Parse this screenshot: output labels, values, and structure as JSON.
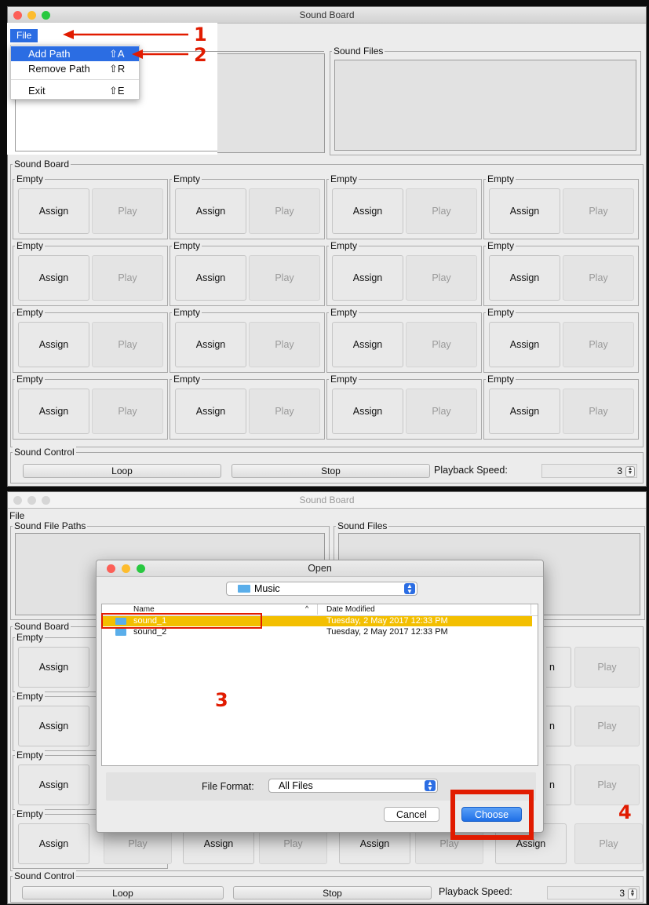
{
  "window1": {
    "title": "Sound Board",
    "menu_file": "File",
    "dropdown": [
      {
        "label": "Add Path",
        "shortcut": "⇧A"
      },
      {
        "label": "Remove Path",
        "shortcut": "⇧R"
      },
      {
        "label": "Exit",
        "shortcut": "⇧E"
      }
    ],
    "sound_files_legend": "Sound Files",
    "sound_board_legend": "Sound Board",
    "sound_control_legend": "Sound Control",
    "cells": [
      {
        "name": "Empty",
        "assign": "Assign",
        "play": "Play"
      },
      {
        "name": "Empty",
        "assign": "Assign",
        "play": "Play"
      },
      {
        "name": "Empty",
        "assign": "Assign",
        "play": "Play"
      },
      {
        "name": "Empty",
        "assign": "Assign",
        "play": "Play"
      },
      {
        "name": "Empty",
        "assign": "Assign",
        "play": "Play"
      },
      {
        "name": "Empty",
        "assign": "Assign",
        "play": "Play"
      },
      {
        "name": "Empty",
        "assign": "Assign",
        "play": "Play"
      },
      {
        "name": "Empty",
        "assign": "Assign",
        "play": "Play"
      },
      {
        "name": "Empty",
        "assign": "Assign",
        "play": "Play"
      },
      {
        "name": "Empty",
        "assign": "Assign",
        "play": "Play"
      },
      {
        "name": "Empty",
        "assign": "Assign",
        "play": "Play"
      },
      {
        "name": "Empty",
        "assign": "Assign",
        "play": "Play"
      },
      {
        "name": "Empty",
        "assign": "Assign",
        "play": "Play"
      },
      {
        "name": "Empty",
        "assign": "Assign",
        "play": "Play"
      },
      {
        "name": "Empty",
        "assign": "Assign",
        "play": "Play"
      },
      {
        "name": "Empty",
        "assign": "Assign",
        "play": "Play"
      }
    ],
    "loop": "Loop",
    "stop": "Stop",
    "speed_label": "Playback Speed:",
    "speed_value": "3"
  },
  "window2": {
    "title": "Sound Board",
    "menu_file": "File",
    "sound_file_paths_legend": "Sound File Paths",
    "sound_files_legend": "Sound Files",
    "sound_board_legend": "Sound Board",
    "left_cells": [
      {
        "name": "Empty",
        "assign": "Assign"
      },
      {
        "name": "Empty",
        "assign": "Assign"
      },
      {
        "name": "Empty",
        "assign": "Assign"
      },
      {
        "name": "Empty",
        "assign": "Assign"
      }
    ],
    "right_partial_label": "n",
    "right_play": "Play",
    "bottom_row": {
      "play1": "Play",
      "assign2": "Assign",
      "play2": "Play",
      "assign3": "Assign",
      "play3": "Play",
      "assign4": "Assign",
      "play4": "Play"
    },
    "sound_control_legend": "Sound Control",
    "loop": "Loop",
    "stop": "Stop",
    "speed_label": "Playback Speed:",
    "speed_value": "3"
  },
  "dialog": {
    "title": "Open",
    "folder": "Music",
    "col_name": "Name",
    "col_date": "Date Modified",
    "files": [
      {
        "name": "sound_1",
        "date": "Tuesday, 2 May 2017 12:33 PM"
      },
      {
        "name": "sound_2",
        "date": "Tuesday, 2 May 2017 12:33 PM"
      }
    ],
    "format_label": "File Format:",
    "format_value": "All Files",
    "cancel": "Cancel",
    "choose": "Choose"
  },
  "annotations": {
    "n1": "1",
    "n2": "2",
    "n3": "3",
    "n4": "4"
  },
  "colors": {
    "accent_red": "#e11b00",
    "menu_selection": "#2b6de3",
    "file_selection": "#f3bf00",
    "traffic_red": "#fc5f57",
    "traffic_yellow": "#fdbc2e",
    "traffic_green": "#28c840"
  }
}
